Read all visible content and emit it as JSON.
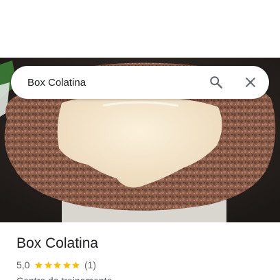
{
  "search": {
    "query": "Box Colatina"
  },
  "place": {
    "name": "Box Colatina",
    "rating": "5,0",
    "stars": 5,
    "review_count": "(1)",
    "category": "Centro de treinamento"
  },
  "colors": {
    "star": "#fbbc04",
    "title_text": "#202124",
    "secondary_text": "#5f6368",
    "icon": "#5f6368"
  },
  "icons": {
    "search": "search-icon",
    "close": "close-icon",
    "star": "star-icon"
  }
}
